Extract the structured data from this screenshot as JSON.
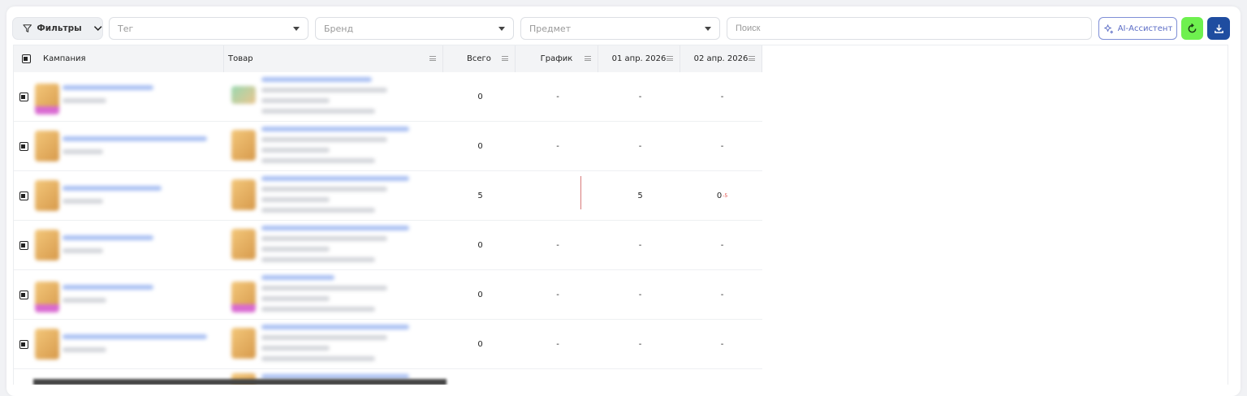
{
  "toolbar": {
    "filters_label": "Фильтры",
    "tag_placeholder": "Тег",
    "brand_placeholder": "Бренд",
    "subject_placeholder": "Предмет",
    "search_placeholder": "Поиск",
    "ai_label": "AI-Ассистент",
    "colors": {
      "ai": "#5a6bc5",
      "refresh": "#6ef04f",
      "download": "#1f4da0"
    }
  },
  "table": {
    "columns": {
      "campaign": "Кампания",
      "product": "Товар",
      "total": "Всего",
      "chart": "График",
      "date1": "01 апр. 2026",
      "date2": "02 апр. 2026"
    },
    "rows": [
      {
        "total": "0",
        "chart": "-",
        "date1": "-",
        "date2": "-"
      },
      {
        "total": "0",
        "chart": "-",
        "date1": "-",
        "date2": "-"
      },
      {
        "total": "5",
        "chart": "",
        "date1": "5",
        "date2": "0",
        "date2_delta": "-5"
      },
      {
        "total": "0",
        "chart": "-",
        "date1": "-",
        "date2": "-"
      },
      {
        "total": "0",
        "chart": "-",
        "date1": "-",
        "date2": "-"
      },
      {
        "total": "0",
        "chart": "-",
        "date1": "-",
        "date2": "-"
      }
    ]
  }
}
